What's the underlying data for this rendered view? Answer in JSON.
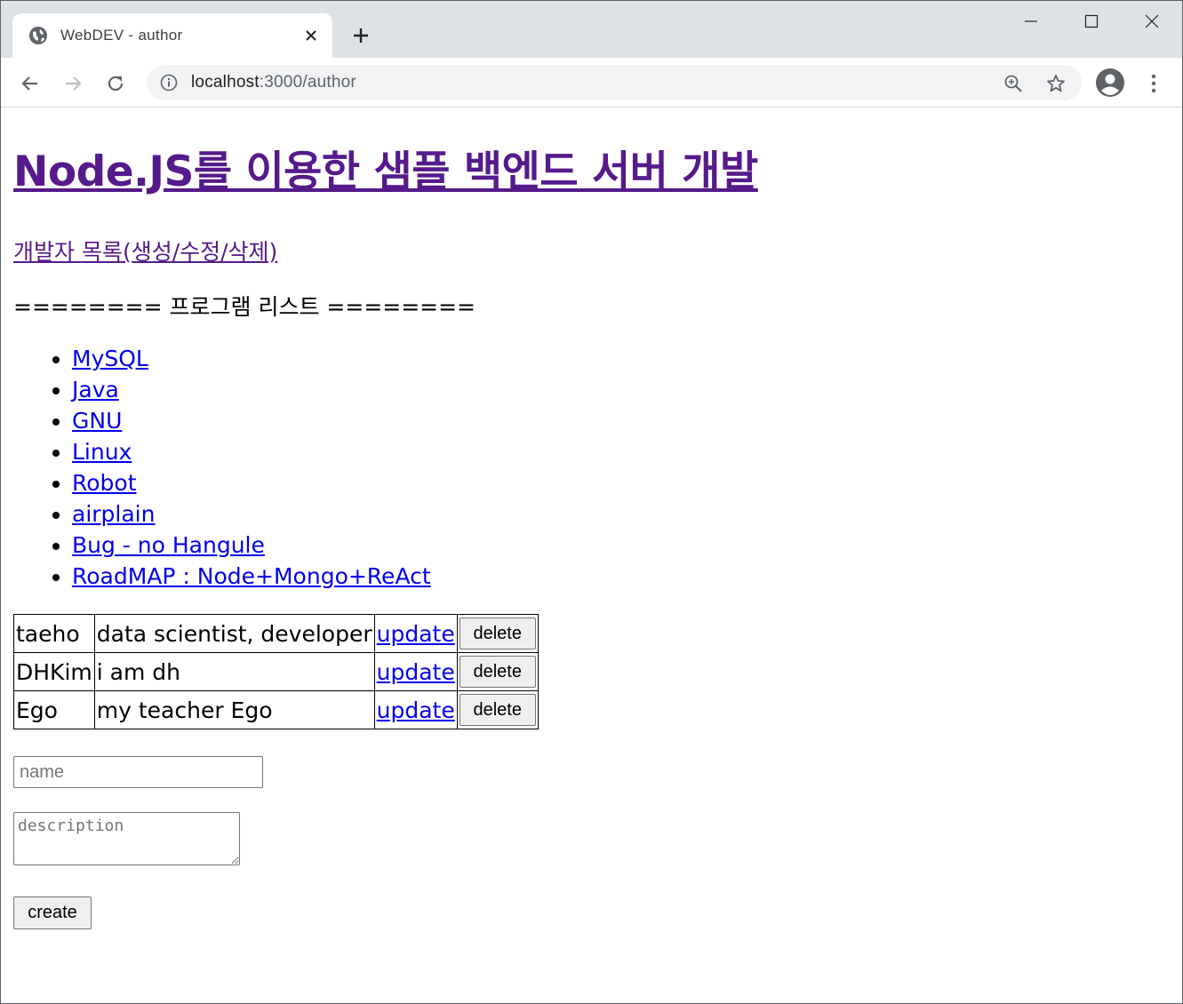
{
  "browser": {
    "tab_title": "WebDEV - author",
    "url_host": "localhost",
    "url_path": ":3000/author"
  },
  "page": {
    "site_title": "Node.JS를 이용한 샘플 백엔드 서버 개발",
    "author_link": "개발자 목록(생성/수정/삭제)",
    "program_header": "======== 프로그램 리스트 ========",
    "topics": [
      "MySQL",
      "Java",
      "GNU",
      "Linux",
      "Robot",
      "airplain",
      "Bug - no Hangule",
      "RoadMAP : Node+Mongo+ReAct"
    ],
    "authors": [
      {
        "name": "taeho",
        "description": "data scientist, developer",
        "update": "update",
        "delete": "delete"
      },
      {
        "name": "DHKim",
        "description": "i am dh",
        "update": "update",
        "delete": "delete"
      },
      {
        "name": "Ego",
        "description": "my teacher Ego",
        "update": "update",
        "delete": "delete"
      }
    ],
    "form": {
      "name_placeholder": "name",
      "description_placeholder": "description",
      "create_label": "create"
    }
  },
  "colors": {
    "visited_link": "#551a8b",
    "link": "#0000ee",
    "tabstrip": "#dee1e6",
    "omnibox": "#f1f3f4"
  },
  "icons": {
    "tab_favicon": "globe-icon",
    "tab_close": "close-icon",
    "new_tab": "plus-icon",
    "minimize": "minimize-icon",
    "maximize": "maximize-icon",
    "window_close": "close-icon",
    "back": "arrow-left-icon",
    "forward": "arrow-right-icon",
    "reload": "reload-icon",
    "site_info": "info-icon",
    "zoom": "zoom-in-icon",
    "bookmark": "star-icon",
    "profile": "account-icon",
    "menu": "more-vert-icon"
  }
}
